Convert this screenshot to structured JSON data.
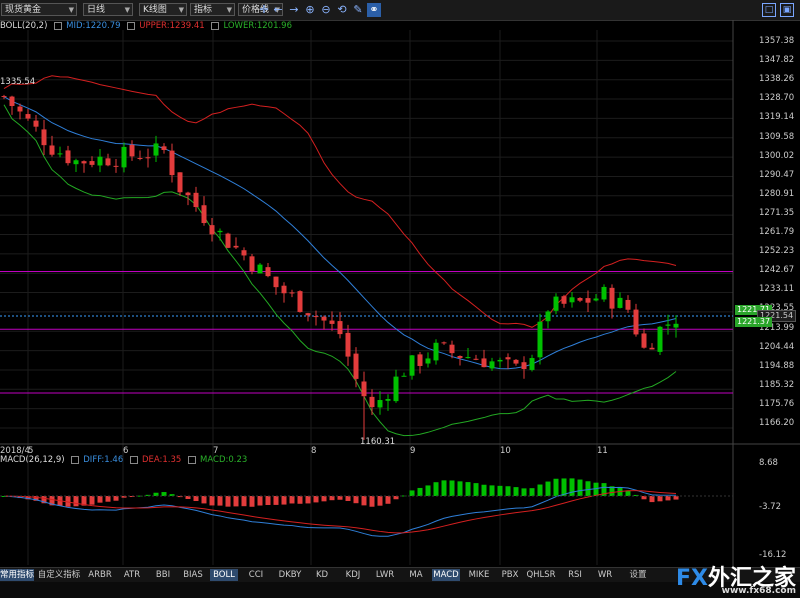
{
  "toolbar": {
    "symbol": "现货黄金",
    "period": "日线",
    "chart_type": "K线图",
    "indicator": "指标",
    "price_line": "价格线"
  },
  "indicators": {
    "boll": {
      "name": "BOLL(20,2)",
      "mid": "MID:1220.79",
      "upper": "UPPER:1239.41",
      "lower": "LOWER:1201.96"
    },
    "macd": {
      "name": "MACD(26,12,9)",
      "diff": "DIFF:1.46",
      "dea": "DEA:1.35",
      "macd": "MACD:0.23"
    }
  },
  "price_axis": [
    "1357.38",
    "1347.82",
    "1338.26",
    "1328.70",
    "1319.14",
    "1309.58",
    "1300.02",
    "1290.47",
    "1280.91",
    "1271.35",
    "1261.79",
    "1252.23",
    "1242.67",
    "1233.11",
    "1223.55",
    "1213.99",
    "1204.44",
    "1194.88",
    "1185.32",
    "1175.76",
    "1166.20"
  ],
  "macd_axis": [
    "8.68",
    "-3.72",
    "-16.12"
  ],
  "price_tags": {
    "tag1": "1221.71",
    "tag2": "1221.54",
    "tag3": "1221.37"
  },
  "annotations": {
    "high": "1335.54",
    "low": "1160.31"
  },
  "dates": [
    "2018/4",
    "5",
    "6",
    "7",
    "8",
    "9",
    "10",
    "11"
  ],
  "tabs": [
    "常用指标",
    "自定义指标",
    "ARBR",
    "ATR",
    "BBI",
    "BIAS",
    "BOLL",
    "CCI",
    "DKBY",
    "KD",
    "KDJ",
    "LWR",
    "MA",
    "MACD",
    "MIKE",
    "PBX",
    "QHLSR",
    "RSI",
    "WR",
    "设置"
  ],
  "active_tabs": [
    "常用指标",
    "BOLL",
    "MACD"
  ],
  "logo": {
    "brand": "FX",
    "name": "外汇之家",
    "url": "www.fx68.com"
  },
  "colors": {
    "up": "#00c000",
    "down": "#e23c3c",
    "upper": "#d42020",
    "mid": "#2f7fd8",
    "lower": "#23a823",
    "hline": "#c000c0",
    "dash": "#3aa0ff",
    "tag_green": "#2aa52a"
  }
}
